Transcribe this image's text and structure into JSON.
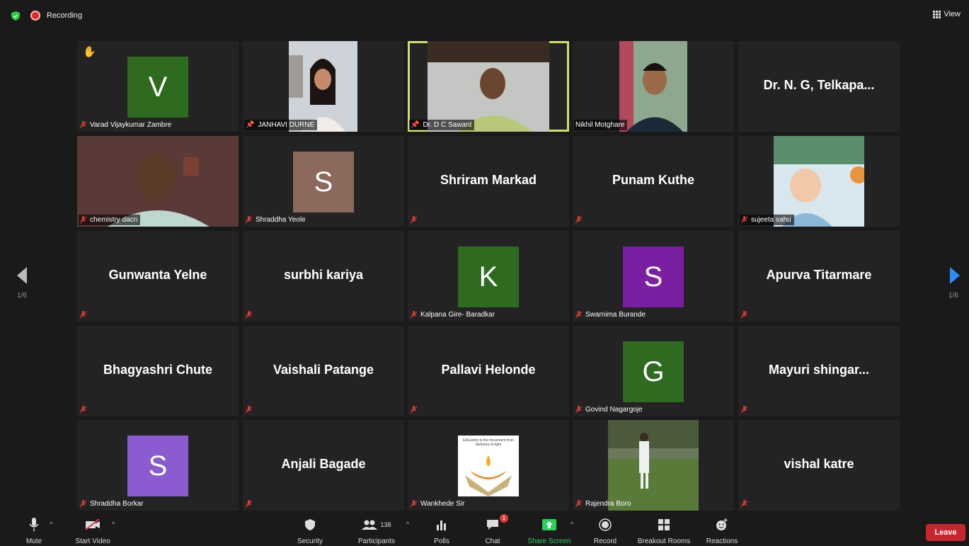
{
  "topbar": {
    "recording_label": "Recording",
    "view_label": "View"
  },
  "pager": {
    "left": "1/6",
    "right": "1/6"
  },
  "tiles": {
    "t00": {
      "name": "Varad Vijaykumar Zambre",
      "initial": "V",
      "color": "#2e6a1f"
    },
    "t01": {
      "name": "JANHAVI DURNE"
    },
    "t02": {
      "name": "Dr. D C Sawant"
    },
    "t03": {
      "name": "Nikhil Motghare"
    },
    "t04": {
      "big": "Dr. N. G, Telkapa..."
    },
    "t10": {
      "name": "chemistry dacn"
    },
    "t11": {
      "name": "Shraddha Yeole",
      "initial": "S",
      "color": "#8b6a5d"
    },
    "t12": {
      "big": "Shriram Markad"
    },
    "t13": {
      "big": "Punam Kuthe"
    },
    "t14": {
      "name": "sujeeta sahu"
    },
    "t20": {
      "big": "Gunwanta Yelne"
    },
    "t21": {
      "big": "surbhi kariya"
    },
    "t22": {
      "name": "Kalpana Gire- Baradkar",
      "initial": "K",
      "color": "#2e6a1f"
    },
    "t23": {
      "name": "Swarnima Burande",
      "initial": "S",
      "color": "#7b1fa2"
    },
    "t24": {
      "big": "Apurva Titarmare"
    },
    "t30": {
      "big": "Bhagyashri Chute"
    },
    "t31": {
      "big": "Vaishali Patange"
    },
    "t32": {
      "big": "Pallavi Helonde"
    },
    "t33": {
      "name": "Govind Nagargoje",
      "initial": "G",
      "color": "#2e6a1f"
    },
    "t34": {
      "big": "Mayuri  shingar..."
    },
    "t40": {
      "name": "Shraddha Borkar",
      "initial": "S",
      "color": "#8a5cd0"
    },
    "t41": {
      "big": "Anjali Bagade"
    },
    "t42": {
      "name": "Wankhede Sir",
      "poster_text": "Education is the movement from darkness to light"
    },
    "t43": {
      "name": "Rajendra Boro"
    },
    "t44": {
      "big": "vishal katre"
    }
  },
  "toolbar": {
    "mute": "Mute",
    "start_video": "Start Video",
    "security": "Security",
    "participants": "Participants",
    "participants_count": "138",
    "polls": "Polls",
    "chat": "Chat",
    "chat_badge": "1",
    "share_screen": "Share Screen",
    "record": "Record",
    "breakout_rooms": "Breakout Rooms",
    "reactions": "Reactions",
    "leave": "Leave"
  },
  "colors": {
    "active_speaker": "#c8e46a",
    "share_green": "#2ad15a",
    "leave_red": "#c8262f"
  }
}
